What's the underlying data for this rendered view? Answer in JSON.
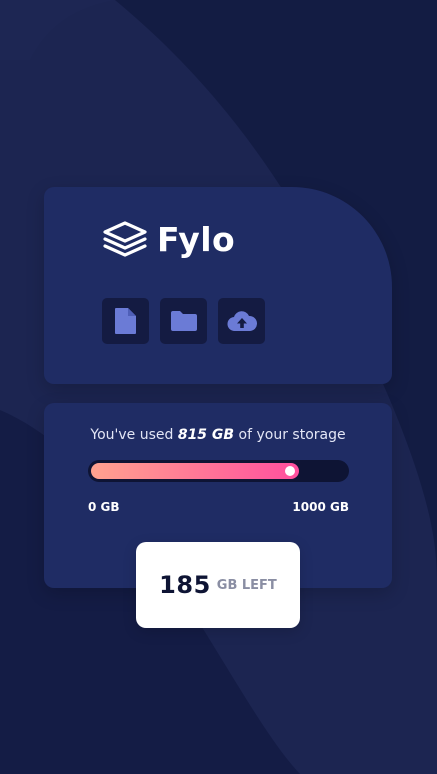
{
  "brand": {
    "name": "Fylo",
    "logo_icon": "stacked-layers-icon"
  },
  "tools": [
    {
      "icon": "document-icon"
    },
    {
      "icon": "folder-icon"
    },
    {
      "icon": "cloud-upload-icon"
    }
  ],
  "storage": {
    "prefix": "You've used",
    "used": "815 GB",
    "suffix": "of your storage",
    "used_fraction": 0.815,
    "min_label": "0 GB",
    "max_label": "1000 GB",
    "remaining_value": "185",
    "remaining_unit": "GB LEFT"
  },
  "colors": {
    "background": "#1c2551",
    "card": "#1f2c64",
    "tile": "#141b42",
    "meter_start": "#ffa28f",
    "meter_end": "#ff4f9e",
    "icon": "#6b7bd6"
  }
}
